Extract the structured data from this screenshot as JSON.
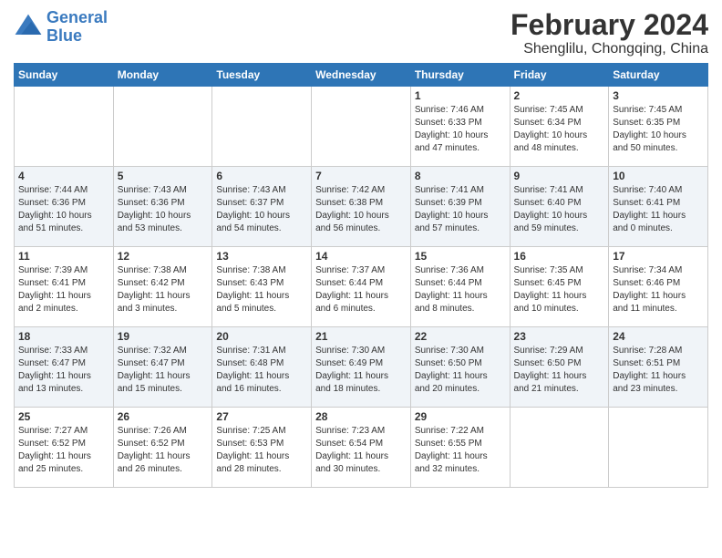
{
  "header": {
    "logo_line1": "General",
    "logo_line2": "Blue",
    "main_title": "February 2024",
    "subtitle": "Shenglilu, Chongqing, China"
  },
  "weekdays": [
    "Sunday",
    "Monday",
    "Tuesday",
    "Wednesday",
    "Thursday",
    "Friday",
    "Saturday"
  ],
  "weeks": [
    [
      {
        "day": "",
        "info": ""
      },
      {
        "day": "",
        "info": ""
      },
      {
        "day": "",
        "info": ""
      },
      {
        "day": "",
        "info": ""
      },
      {
        "day": "1",
        "info": "Sunrise: 7:46 AM\nSunset: 6:33 PM\nDaylight: 10 hours\nand 47 minutes."
      },
      {
        "day": "2",
        "info": "Sunrise: 7:45 AM\nSunset: 6:34 PM\nDaylight: 10 hours\nand 48 minutes."
      },
      {
        "day": "3",
        "info": "Sunrise: 7:45 AM\nSunset: 6:35 PM\nDaylight: 10 hours\nand 50 minutes."
      }
    ],
    [
      {
        "day": "4",
        "info": "Sunrise: 7:44 AM\nSunset: 6:36 PM\nDaylight: 10 hours\nand 51 minutes."
      },
      {
        "day": "5",
        "info": "Sunrise: 7:43 AM\nSunset: 6:36 PM\nDaylight: 10 hours\nand 53 minutes."
      },
      {
        "day": "6",
        "info": "Sunrise: 7:43 AM\nSunset: 6:37 PM\nDaylight: 10 hours\nand 54 minutes."
      },
      {
        "day": "7",
        "info": "Sunrise: 7:42 AM\nSunset: 6:38 PM\nDaylight: 10 hours\nand 56 minutes."
      },
      {
        "day": "8",
        "info": "Sunrise: 7:41 AM\nSunset: 6:39 PM\nDaylight: 10 hours\nand 57 minutes."
      },
      {
        "day": "9",
        "info": "Sunrise: 7:41 AM\nSunset: 6:40 PM\nDaylight: 10 hours\nand 59 minutes."
      },
      {
        "day": "10",
        "info": "Sunrise: 7:40 AM\nSunset: 6:41 PM\nDaylight: 11 hours\nand 0 minutes."
      }
    ],
    [
      {
        "day": "11",
        "info": "Sunrise: 7:39 AM\nSunset: 6:41 PM\nDaylight: 11 hours\nand 2 minutes."
      },
      {
        "day": "12",
        "info": "Sunrise: 7:38 AM\nSunset: 6:42 PM\nDaylight: 11 hours\nand 3 minutes."
      },
      {
        "day": "13",
        "info": "Sunrise: 7:38 AM\nSunset: 6:43 PM\nDaylight: 11 hours\nand 5 minutes."
      },
      {
        "day": "14",
        "info": "Sunrise: 7:37 AM\nSunset: 6:44 PM\nDaylight: 11 hours\nand 6 minutes."
      },
      {
        "day": "15",
        "info": "Sunrise: 7:36 AM\nSunset: 6:44 PM\nDaylight: 11 hours\nand 8 minutes."
      },
      {
        "day": "16",
        "info": "Sunrise: 7:35 AM\nSunset: 6:45 PM\nDaylight: 11 hours\nand 10 minutes."
      },
      {
        "day": "17",
        "info": "Sunrise: 7:34 AM\nSunset: 6:46 PM\nDaylight: 11 hours\nand 11 minutes."
      }
    ],
    [
      {
        "day": "18",
        "info": "Sunrise: 7:33 AM\nSunset: 6:47 PM\nDaylight: 11 hours\nand 13 minutes."
      },
      {
        "day": "19",
        "info": "Sunrise: 7:32 AM\nSunset: 6:47 PM\nDaylight: 11 hours\nand 15 minutes."
      },
      {
        "day": "20",
        "info": "Sunrise: 7:31 AM\nSunset: 6:48 PM\nDaylight: 11 hours\nand 16 minutes."
      },
      {
        "day": "21",
        "info": "Sunrise: 7:30 AM\nSunset: 6:49 PM\nDaylight: 11 hours\nand 18 minutes."
      },
      {
        "day": "22",
        "info": "Sunrise: 7:30 AM\nSunset: 6:50 PM\nDaylight: 11 hours\nand 20 minutes."
      },
      {
        "day": "23",
        "info": "Sunrise: 7:29 AM\nSunset: 6:50 PM\nDaylight: 11 hours\nand 21 minutes."
      },
      {
        "day": "24",
        "info": "Sunrise: 7:28 AM\nSunset: 6:51 PM\nDaylight: 11 hours\nand 23 minutes."
      }
    ],
    [
      {
        "day": "25",
        "info": "Sunrise: 7:27 AM\nSunset: 6:52 PM\nDaylight: 11 hours\nand 25 minutes."
      },
      {
        "day": "26",
        "info": "Sunrise: 7:26 AM\nSunset: 6:52 PM\nDaylight: 11 hours\nand 26 minutes."
      },
      {
        "day": "27",
        "info": "Sunrise: 7:25 AM\nSunset: 6:53 PM\nDaylight: 11 hours\nand 28 minutes."
      },
      {
        "day": "28",
        "info": "Sunrise: 7:23 AM\nSunset: 6:54 PM\nDaylight: 11 hours\nand 30 minutes."
      },
      {
        "day": "29",
        "info": "Sunrise: 7:22 AM\nSunset: 6:55 PM\nDaylight: 11 hours\nand 32 minutes."
      },
      {
        "day": "",
        "info": ""
      },
      {
        "day": "",
        "info": ""
      }
    ]
  ]
}
